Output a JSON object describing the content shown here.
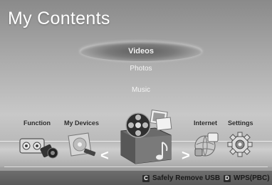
{
  "header": {
    "title": "My Contents"
  },
  "menu": {
    "items": [
      {
        "label": "Videos",
        "selected": true
      },
      {
        "label": "Photos",
        "selected": false
      },
      {
        "label": "Music",
        "selected": false
      }
    ]
  },
  "categories": [
    {
      "label": "Function",
      "icon": "function-icon"
    },
    {
      "label": "My Devices",
      "icon": "usb-device-icon"
    },
    {
      "label": "",
      "icon": "my-contents-icon",
      "selected": true
    },
    {
      "label": "Internet",
      "icon": "internet-icon"
    },
    {
      "label": "Settings",
      "icon": "settings-gear-icon"
    }
  ],
  "nav": {
    "left_arrow": "<",
    "right_arrow": ">"
  },
  "footer": {
    "hints": [
      {
        "key": "C",
        "label": "Safely Remove USB"
      },
      {
        "key": "D",
        "label": "WPS(PBC)"
      }
    ]
  }
}
